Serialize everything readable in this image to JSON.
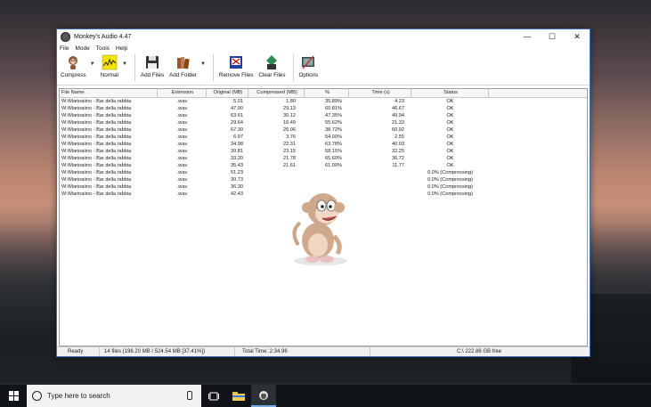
{
  "window": {
    "title": "Monkey's Audio 4.47",
    "controls": [
      "—",
      "☐",
      "✕"
    ]
  },
  "menu": [
    "File",
    "Mode",
    "Tools",
    "Help"
  ],
  "toolbar": {
    "compress": "Compress",
    "normal": "Normal",
    "add_files": "Add Files",
    "add_folder": "Add Folder",
    "remove_files": "Remove Files",
    "clear_files": "Clear Files",
    "options": "Options"
  },
  "columns": [
    "File Name",
    "Extension",
    "Original (MB)",
    "Compressed (MB)",
    "%",
    "Time (s)",
    "Status"
  ],
  "rows": [
    {
      "name": "W:\\Marinaiino - Bar della rabbia",
      "ext": ".wav",
      "orig": "5.01",
      "comp": "1.80",
      "pct": "35.89%",
      "time": "4.23",
      "status": "OK"
    },
    {
      "name": "W:\\Marinaiino - Bar della rabbia",
      "ext": ".wav",
      "orig": "47.90",
      "comp": "29.13",
      "pct": "60.81%",
      "time": "46.67",
      "status": "OK"
    },
    {
      "name": "W:\\Marinaiino - Bar della rabbia",
      "ext": ".wav",
      "orig": "63.61",
      "comp": "30.12",
      "pct": "47.35%",
      "time": "49.94",
      "status": "OK"
    },
    {
      "name": "W:\\Marinaiino - Bar della rabbia",
      "ext": ".wav",
      "orig": "29.64",
      "comp": "16.49",
      "pct": "55.62%",
      "time": "21.33",
      "status": "OK"
    },
    {
      "name": "W:\\Marinaiino - Bar della rabbia",
      "ext": ".wav",
      "orig": "67.30",
      "comp": "26.06",
      "pct": "38.72%",
      "time": "60.92",
      "status": "OK"
    },
    {
      "name": "W:\\Marinaiino - Bar della rabbia",
      "ext": ".wav",
      "orig": "6.97",
      "comp": "3.76",
      "pct": "54.00%",
      "time": "2.55",
      "status": "OK"
    },
    {
      "name": "W:\\Marinaiino - Bar della rabbia",
      "ext": ".wav",
      "orig": "34.98",
      "comp": "22.31",
      "pct": "63.78%",
      "time": "40.03",
      "status": "OK"
    },
    {
      "name": "W:\\Marinaiino - Bar della rabbia",
      "ext": ".wav",
      "orig": "39.81",
      "comp": "23.15",
      "pct": "58.15%",
      "time": "32.25",
      "status": "OK"
    },
    {
      "name": "W:\\Marinaiino - Bar della rabbia",
      "ext": ".wav",
      "orig": "33.20",
      "comp": "21.78",
      "pct": "65.60%",
      "time": "36.72",
      "status": "OK"
    },
    {
      "name": "W:\\Marinaiino - Bar della rabbia",
      "ext": ".wav",
      "orig": "35.43",
      "comp": "21.61",
      "pct": "61.00%",
      "time": "11.77",
      "status": "OK"
    },
    {
      "name": "W:\\Marinaiino - Bar della rabbia",
      "ext": ".wav",
      "orig": "51.23",
      "comp": "",
      "pct": "",
      "time": "",
      "status": "0.0% (Compressing)"
    },
    {
      "name": "W:\\Marinaiino - Bar della rabbia",
      "ext": ".wav",
      "orig": "30.73",
      "comp": "",
      "pct": "",
      "time": "",
      "status": "0.0% (Compressing)"
    },
    {
      "name": "W:\\Marinaiino - Bar della rabbia",
      "ext": ".wav",
      "orig": "36.30",
      "comp": "",
      "pct": "",
      "time": "",
      "status": "0.0% (Compressing)"
    },
    {
      "name": "W:\\Marinaiino - Bar della rabbia",
      "ext": ".wav",
      "orig": "42.43",
      "comp": "",
      "pct": "",
      "time": "",
      "status": "0.0% (Compressing)"
    }
  ],
  "statusbar": {
    "state": "Ready",
    "files": "14 files (196.20 MB / 524.54 MB [37.41%])",
    "total_time": "Total Time: 2:34.96",
    "free": "C:\\ 222.86 GB free"
  },
  "taskbar": {
    "search_placeholder": "Type here to search"
  }
}
